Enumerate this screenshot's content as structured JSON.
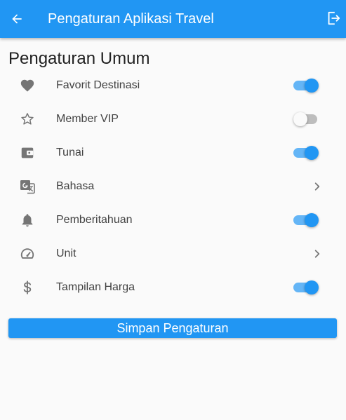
{
  "appbar": {
    "title": "Pengaturan Aplikasi Travel",
    "back_icon": "arrow-left-icon",
    "logout_icon": "logout-icon",
    "color": "#2196f3"
  },
  "section": {
    "title": "Pengaturan Umum"
  },
  "settings": [
    {
      "label": "Favorit Destinasi",
      "icon": "heart-icon",
      "control": "switch",
      "on": true
    },
    {
      "label": "Member VIP",
      "icon": "star-outline-icon",
      "control": "switch",
      "on": false
    },
    {
      "label": "Tunai",
      "icon": "wallet-icon",
      "control": "switch",
      "on": true
    },
    {
      "label": "Bahasa",
      "icon": "translate-icon",
      "control": "chevron"
    },
    {
      "label": "Pemberitahuan",
      "icon": "bell-icon",
      "control": "switch",
      "on": true
    },
    {
      "label": "Unit",
      "icon": "speedometer-icon",
      "control": "chevron"
    },
    {
      "label": "Tampilan Harga",
      "icon": "dollar-icon",
      "control": "switch",
      "on": true
    }
  ],
  "save_button": {
    "label": "Simpan Pengaturan"
  },
  "colors": {
    "accent": "#2196f3",
    "accent_light": "#64b5f6",
    "icon": "#757575"
  }
}
